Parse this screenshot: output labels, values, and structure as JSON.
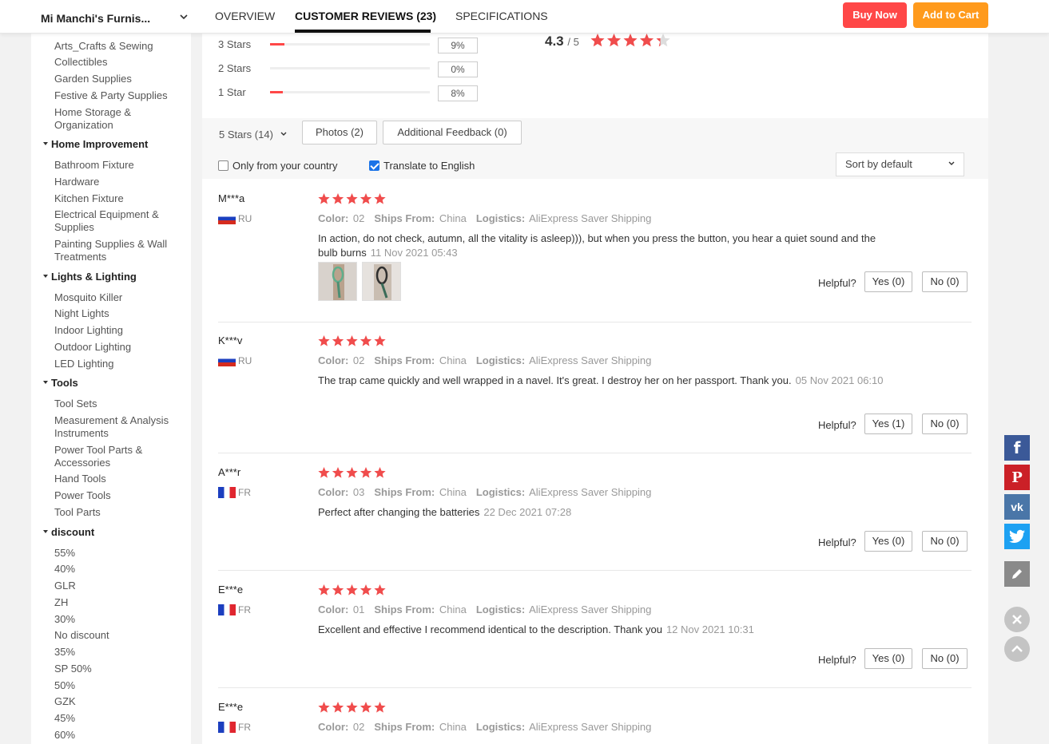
{
  "header": {
    "store_name": "Mi Manchi's Furnis...",
    "tabs": [
      "OVERVIEW",
      "CUSTOMER REVIEWS (23)",
      "SPECIFICATIONS"
    ],
    "buy_now": "Buy Now",
    "add_to_cart": "Add to Cart"
  },
  "sidebar": {
    "items_a": [
      "Arts_Crafts & Sewing",
      "Collectibles",
      "Garden Supplies",
      "Festive & Party Supplies",
      "Home Storage &",
      "Organization"
    ],
    "cat_home": "Home Improvement",
    "items_home": [
      "Bathroom Fixture",
      "Hardware",
      "Kitchen Fixture",
      "Electrical Equipment &",
      "Supplies",
      "Painting Supplies & Wall",
      "Treatments"
    ],
    "cat_lights": "Lights & Lighting",
    "items_lights": [
      "Mosquito Killer",
      "Night Lights",
      "Indoor Lighting",
      "Outdoor Lighting",
      "LED Lighting"
    ],
    "cat_tools": "Tools",
    "items_tools": [
      "Tool Sets",
      "Measurement & Analysis",
      "Instruments",
      "Power Tool Parts &",
      "Accessories",
      "Hand Tools",
      "Power Tools",
      "Tool Parts"
    ],
    "cat_discount": "discount",
    "items_discount": [
      "55%",
      "40%",
      "GLR",
      "ZH",
      "30%",
      "No discount",
      "35%",
      "SP 50%",
      "50%",
      "GZK",
      "45%",
      "60%"
    ]
  },
  "rating": {
    "distribution": [
      {
        "label": "3 Stars",
        "percent": 9,
        "pct_text": "9%"
      },
      {
        "label": "2 Stars",
        "percent": 0,
        "pct_text": "0%"
      },
      {
        "label": "1 Star",
        "percent": 8,
        "pct_text": "8%"
      }
    ],
    "average": "4.3",
    "out_of": "/ 5",
    "average_stars": 4.3
  },
  "filters": {
    "stars_filter": "5 Stars (14)",
    "photos": "Photos (2)",
    "additional": "Additional Feedback (0)",
    "only_country": "Only from your country",
    "only_country_checked": false,
    "translate": "Translate to English",
    "translate_checked": true,
    "sort": "Sort by default"
  },
  "labels": {
    "color": "Color:",
    "ships_from": "Ships From:",
    "logistics": "Logistics:",
    "helpful": "Helpful?"
  },
  "reviews": [
    {
      "name": "M***a",
      "country": "RU",
      "color": "02",
      "ships": "China",
      "logistics": "AliExpress Saver Shipping",
      "text": "In action, do not check, autumn, all the vitality is asleep))), but when you press the button, you hear a quiet sound and the bulb burns",
      "date": "11 Nov 2021 05:43",
      "yes": "Yes (0)",
      "no": "No (0)",
      "stars": 5
    },
    {
      "name": "K***v",
      "country": "RU",
      "color": "02",
      "ships": "China",
      "logistics": "AliExpress Saver Shipping",
      "text": "The trap came quickly and well wrapped in a navel. It's great. I destroy her on her passport. Thank you.",
      "date": "05 Nov 2021 06:10",
      "yes": "Yes (1)",
      "no": "No (0)",
      "stars": 5
    },
    {
      "name": "A***r",
      "country": "FR",
      "color": "03",
      "ships": "China",
      "logistics": "AliExpress Saver Shipping",
      "text": "Perfect after changing the batteries",
      "date": "22 Dec 2021 07:28",
      "yes": "Yes (0)",
      "no": "No (0)",
      "stars": 5
    },
    {
      "name": "E***e",
      "country": "FR",
      "color": "01",
      "ships": "China",
      "logistics": "AliExpress Saver Shipping",
      "text": "Excellent and effective I recommend identical to the description. Thank you",
      "date": "12 Nov 2021 10:31",
      "yes": "Yes (0)",
      "no": "No (0)",
      "stars": 5
    },
    {
      "name": "E***e",
      "country": "FR",
      "color": "02",
      "ships": "China",
      "logistics": "AliExpress Saver Shipping",
      "stars": 5
    }
  ],
  "social": {
    "facebook": "f",
    "pinterest": "P",
    "vk": "vk"
  },
  "colors": {
    "accent_red": "#ff4747",
    "accent_orange": "#ff9a1c",
    "star": "#f04c4c",
    "facebook": "#3b5998",
    "pinterest": "#cb2027",
    "vk": "#4a76a8",
    "twitter": "#1da1f2"
  }
}
